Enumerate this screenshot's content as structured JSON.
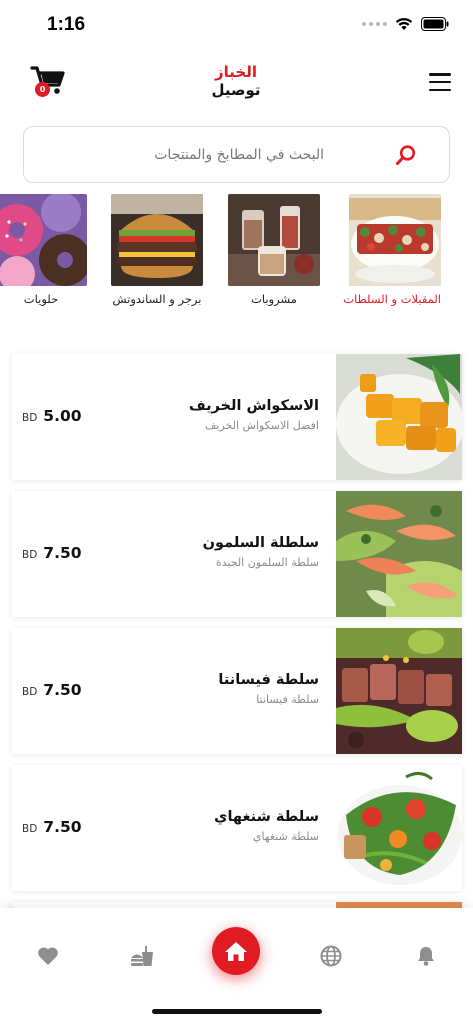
{
  "status_bar": {
    "time": "1:16"
  },
  "header": {
    "logo_top": "الخباز",
    "logo_bottom": "توصيل",
    "cart_count": "0"
  },
  "search": {
    "placeholder": "البحث في المطابخ والمنتجات"
  },
  "categories": [
    {
      "label": "المقبلات و السلطات",
      "active": true,
      "image": "appetizer-salad-photo"
    },
    {
      "label": "مشروبات",
      "active": false,
      "image": "drinks-photo"
    },
    {
      "label": "برجر و الساندوتش",
      "active": false,
      "image": "burger-photo"
    },
    {
      "label": "حلويات",
      "active": false,
      "image": "donuts-photo"
    }
  ],
  "foods": [
    {
      "name": "الاسكواش الخريف",
      "description": "افضل الاسكواش الخريف",
      "price": "5.00",
      "currency": "BD",
      "image": "squash-photo"
    },
    {
      "name": "سلطلة السلمون",
      "description": "سلطة السلمون الجيدة",
      "price": "7.50",
      "currency": "BD",
      "image": "salmon-salad-photo"
    },
    {
      "name": "سلطة فيسانتا",
      "description": "سلطة فيسانتا",
      "price": "7.50",
      "currency": "BD",
      "image": "steak-salad-photo"
    },
    {
      "name": "سلطة شنغهاي",
      "description": "سلطة شنغهاي",
      "price": "7.50",
      "currency": "BD",
      "image": "shanghai-salad-photo"
    }
  ],
  "bottom_nav": [
    "heart-icon",
    "fastfood-icon",
    "home-icon",
    "globe-icon",
    "bell-icon"
  ],
  "colors": {
    "accent": "#e11b22",
    "text": "#111111",
    "muted": "#8a8a8a"
  }
}
